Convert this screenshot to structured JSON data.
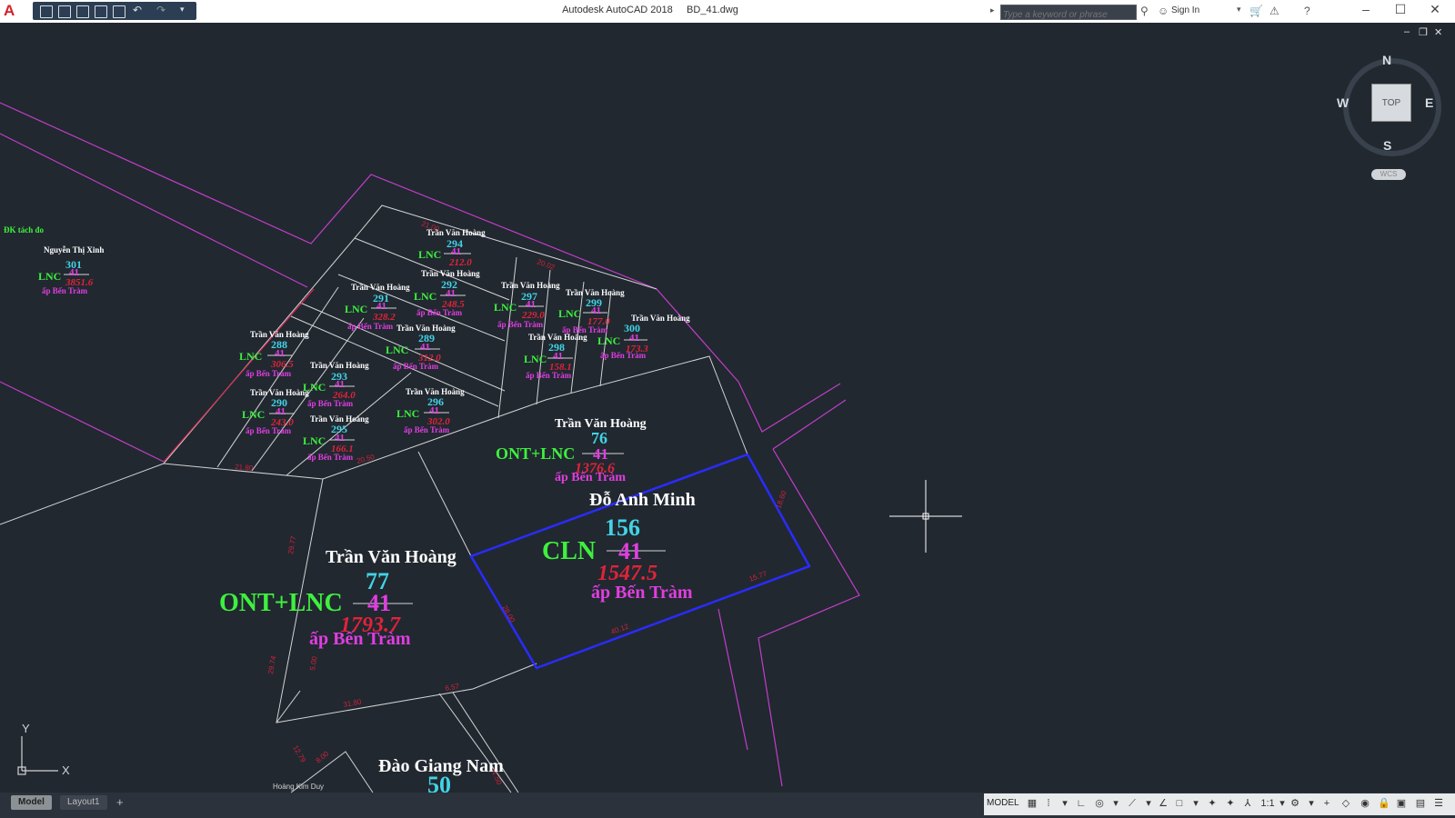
{
  "titlebar": {
    "app_name": "Autodesk AutoCAD 2018",
    "file_name": "BD_41.dwg",
    "search_placeholder": "Type a keyword or phrase",
    "sign_in": "Sign In"
  },
  "viewcube": {
    "top": "TOP",
    "north": "N",
    "south": "S",
    "east": "E",
    "west": "W",
    "wcs": "WCS"
  },
  "tabs": [
    "Model",
    "Layout1",
    "+"
  ],
  "status": {
    "model": "MODEL",
    "scale": "1:1"
  },
  "ucs": {
    "y": "Y",
    "x": "X"
  },
  "labels": {
    "dk": "ĐK tách đo",
    "hoang_kim_duy": "Hoàng Kim Duy"
  },
  "parcels": [
    {
      "owner": "Nguyễn Thị Xinh",
      "number": "301",
      "use": "LNC",
      "sheet": "41",
      "area": "3851.6",
      "place": "ấp Bến Tràm"
    },
    {
      "owner": "Trần Văn Hoàng",
      "number": "294",
      "use": "LNC",
      "sheet": "41",
      "area": "212.0",
      "place": "ấp Bến Tràm"
    },
    {
      "owner": "Trần Văn Hoàng",
      "number": "292",
      "use": "LNC",
      "sheet": "41",
      "area": "248.5",
      "place": "ấp Bến Tràm"
    },
    {
      "owner": "Trần Văn Hoàng",
      "number": "291",
      "use": "LNC",
      "sheet": "41",
      "area": "328.2",
      "place": "ấp Bến Tràm"
    },
    {
      "owner": "Trần Văn Hoàng",
      "number": "297",
      "use": "LNC",
      "sheet": "41",
      "area": "229.0",
      "place": "ấp Bến Tràm"
    },
    {
      "owner": "Trần Văn Hoàng",
      "number": "299",
      "use": "LNC",
      "sheet": "41",
      "area": "177.0",
      "place": "ấp Bến Tràm"
    },
    {
      "owner": "Trần Văn Hoàng",
      "number": "300",
      "use": "LNC",
      "sheet": "41",
      "area": "173.3",
      "place": "ấp Bến Tràm"
    },
    {
      "owner": "Trần Văn Hoàng",
      "number": "289",
      "use": "LNC",
      "sheet": "41",
      "area": "312.0",
      "place": "ấp Bến Tràm"
    },
    {
      "owner": "Trần Văn Hoàng",
      "number": "298",
      "use": "LNC",
      "sheet": "41",
      "area": "158.1",
      "place": "ấp Bến Tràm"
    },
    {
      "owner": "Trần Văn Hoàng",
      "number": "288",
      "use": "LNC",
      "sheet": "41",
      "area": "306.5",
      "place": "ấp Bến Tràm"
    },
    {
      "owner": "Trần Văn Hoàng",
      "number": "293",
      "use": "LNC",
      "sheet": "41",
      "area": "264.0",
      "place": "ấp Bến Tràm"
    },
    {
      "owner": "Trần Văn Hoàng",
      "number": "290",
      "use": "LNC",
      "sheet": "41",
      "area": "243.0",
      "place": "ấp Bến Tràm"
    },
    {
      "owner": "Trần Văn Hoàng",
      "number": "296",
      "use": "LNC",
      "sheet": "41",
      "area": "302.0",
      "place": "ấp Bến Tràm"
    },
    {
      "owner": "Trần Văn Hoàng",
      "number": "295",
      "use": "LNC",
      "sheet": "41",
      "area": "166.1",
      "place": "ấp Bến Tràm"
    },
    {
      "owner": "Trần Văn Hoàng",
      "number": "76",
      "use": "ONT+LNC",
      "sheet": "41",
      "area": "1376.6",
      "place": "ấp Bến Tràm"
    },
    {
      "owner": "Đỗ Anh Minh",
      "number": "156",
      "use": "CLN",
      "sheet": "41",
      "area": "1547.5",
      "place": "ấp Bến Tràm"
    },
    {
      "owner": "Trần Văn Hoàng",
      "number": "77",
      "use": "ONT+LNC",
      "sheet": "41",
      "area": "1793.7",
      "place": "ấp Bến Tràm"
    },
    {
      "owner": "Đào Giang Nam",
      "number": "50"
    }
  ],
  "dimensions": [
    "20.02",
    "29.77",
    "40.12",
    "15.77",
    "21.80",
    "29.74",
    "31.80",
    "12.79",
    "8.00",
    "31.50",
    "18.60",
    "6.57",
    "20.50",
    "28.00",
    "21.00",
    "5.00"
  ],
  "colors": {
    "background": "#212830",
    "owner": "#ffffff",
    "number": "#43d3e6",
    "use": "#3ef03e",
    "sheet": "#e03ee0",
    "area": "#e0233a",
    "place": "#e03ee0",
    "boundary": "#d3d3d3",
    "road": "#c23ec9",
    "highlight": "#2a2cff",
    "dimension": "#d0223a"
  }
}
